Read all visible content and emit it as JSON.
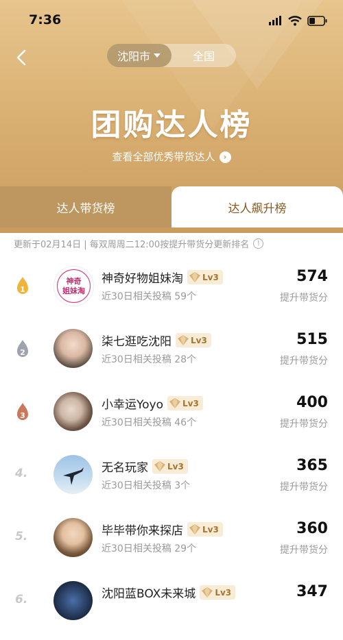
{
  "status_bar": {
    "time": "7:36"
  },
  "header": {
    "city_selected": "沈阳市",
    "city_other": "全国",
    "title": "团购达人榜",
    "view_all": "查看全部优秀带货达人"
  },
  "tabs": [
    {
      "label": "达人带货榜",
      "active": false
    },
    {
      "label": "达人飙升榜",
      "active": true
    }
  ],
  "update_note": "更新于02月14日 | 每双周周二12:00按提升带货分更新排名",
  "list": [
    {
      "rank": "1",
      "name": "神奇好物姐妹淘",
      "level": "Lv3",
      "sub": "近30日相关投稿 59个",
      "score": "574",
      "score_label": "提升带货分",
      "avatar_text": "神奇姐妹淘"
    },
    {
      "rank": "2",
      "name": "柒七逛吃沈阳",
      "level": "Lv3",
      "sub": "近30日相关投稿 28个",
      "score": "515",
      "score_label": "提升带货分"
    },
    {
      "rank": "3",
      "name": "小幸运Yoyo",
      "level": "Lv3",
      "sub": "近30日相关投稿 46个",
      "score": "400",
      "score_label": "提升带货分"
    },
    {
      "rank": "4.",
      "name": "无名玩家",
      "level": "Lv3",
      "sub": "近30日相关投稿 3个",
      "score": "365",
      "score_label": "提升带货分"
    },
    {
      "rank": "5.",
      "name": "毕毕带你来探店",
      "level": "Lv3",
      "sub": "近30日相关投稿 29个",
      "score": "360",
      "score_label": "提升带货分"
    },
    {
      "rank": "6.",
      "name": "沈阳蓝BOX未来城",
      "level": "Lv3",
      "sub": "",
      "score": "347",
      "score_label": ""
    }
  ],
  "colors": {
    "gold_bg": "#d8ae70",
    "tab_inactive": "#be965f",
    "tab_active_text": "#8a5a22",
    "badge_bg": "#f8ecd6"
  }
}
